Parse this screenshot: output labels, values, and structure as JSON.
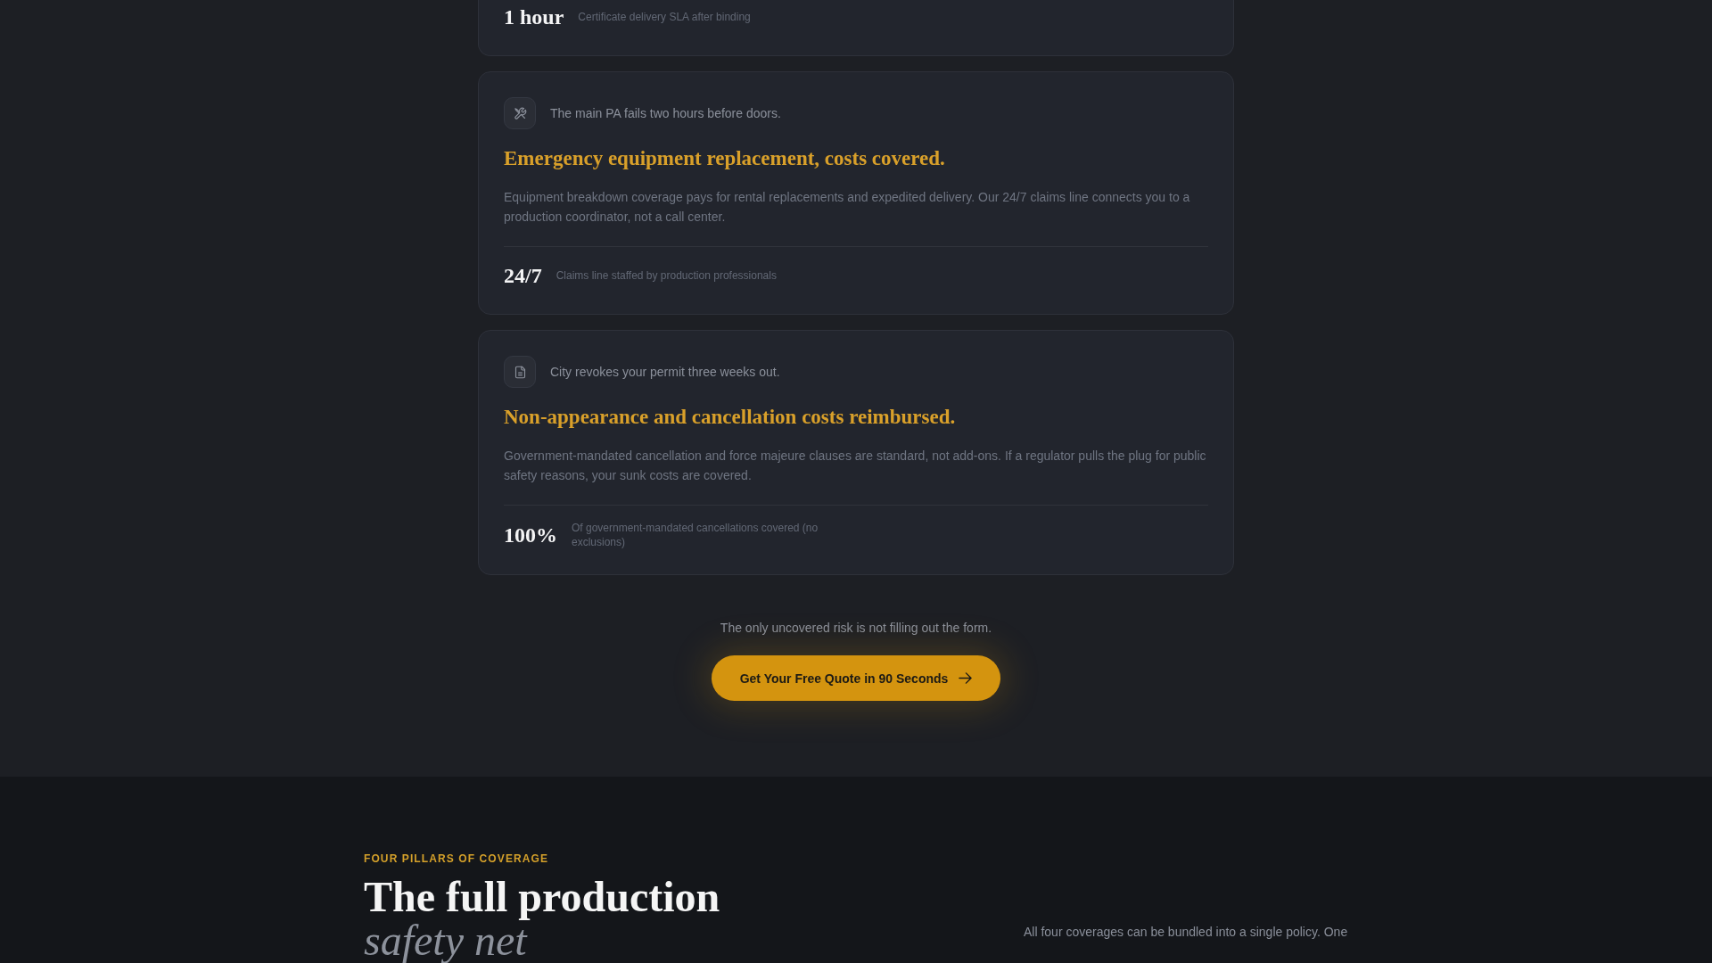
{
  "cards": [
    {
      "kind": "partial",
      "stat": {
        "value": "1 hour",
        "label": "Certificate delivery SLA after binding"
      }
    },
    {
      "kind": "full",
      "scenario": "The main PA fails two hours before doors.",
      "title": "Emergency equipment replacement, costs covered.",
      "description": "Equipment breakdown coverage pays for rental replacements and expedited delivery. Our 24/7 claims line connects you to a production coordinator, not a call center.",
      "stat": {
        "value": "24/7",
        "label": "Claims line staffed by production professionals"
      }
    },
    {
      "kind": "full",
      "scenario": "City revokes your permit three weeks out.",
      "title": "Non-appearance and cancellation costs reimbursed.",
      "description": "Government-mandated cancellation and force majeure clauses are standard, not add-ons. If a regulator pulls the plug for public safety reasons, your sunk costs are covered.",
      "stat": {
        "value": "100%",
        "label": "Of government-mandated cancellations covered (no exclusions)"
      }
    }
  ],
  "cta": {
    "tagline": "The only uncovered risk is not filling out the form.",
    "button": "Get Your Free Quote in 90 Seconds"
  },
  "coverage_intro": {
    "eyebrow": "FOUR PILLARS OF COVERAGE",
    "title": "The full production *safety net*",
    "text": "All four coverages can be bundled into a single policy. One"
  }
}
